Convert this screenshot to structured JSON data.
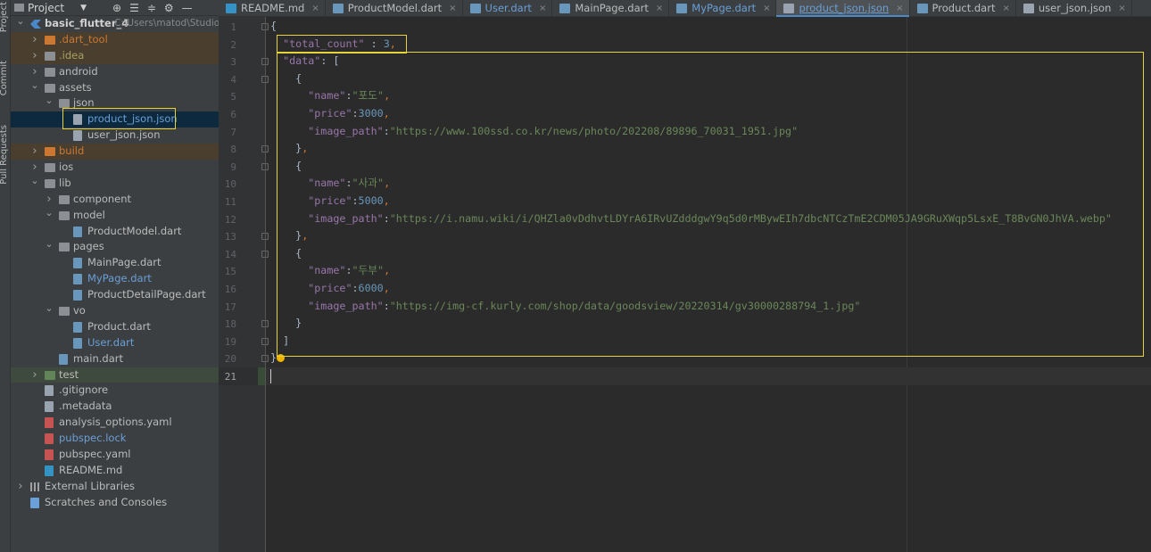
{
  "side_strip": {
    "labels": [
      "Project",
      "Commit",
      "Pull Requests"
    ]
  },
  "project_panel": {
    "title": "Project",
    "tree": [
      {
        "label": "basic_flutter_4",
        "suffix": "C:\\Users\\matod\\Studio",
        "depth": 0,
        "type": "root",
        "expanded": true
      },
      {
        "label": ".dart_tool",
        "depth": 1,
        "type": "folder-orange",
        "expanded": false,
        "style": "orange",
        "bg": "orange"
      },
      {
        "label": ".idea",
        "depth": 1,
        "type": "folder",
        "expanded": false,
        "style": "olive",
        "bg": "orange"
      },
      {
        "label": "android",
        "depth": 1,
        "type": "folder",
        "expanded": false
      },
      {
        "label": "assets",
        "depth": 1,
        "type": "folder",
        "expanded": true
      },
      {
        "label": "json",
        "depth": 2,
        "type": "folder",
        "expanded": true
      },
      {
        "label": "product_json.json",
        "depth": 3,
        "type": "json",
        "selected": true
      },
      {
        "label": "user_json.json",
        "depth": 3,
        "type": "json"
      },
      {
        "label": "build",
        "depth": 1,
        "type": "folder-orange",
        "expanded": false,
        "style": "orange",
        "bg": "orange"
      },
      {
        "label": "ios",
        "depth": 1,
        "type": "folder",
        "expanded": false
      },
      {
        "label": "lib",
        "depth": 1,
        "type": "folder",
        "expanded": true
      },
      {
        "label": "component",
        "depth": 2,
        "type": "folder",
        "expanded": false
      },
      {
        "label": "model",
        "depth": 2,
        "type": "folder",
        "expanded": true
      },
      {
        "label": "ProductModel.dart",
        "depth": 3,
        "type": "dart"
      },
      {
        "label": "pages",
        "depth": 2,
        "type": "folder",
        "expanded": true
      },
      {
        "label": "MainPage.dart",
        "depth": 3,
        "type": "dart"
      },
      {
        "label": "MyPage.dart",
        "depth": 3,
        "type": "dart",
        "style": "blue"
      },
      {
        "label": "ProductDetailPage.dart",
        "depth": 3,
        "type": "dart"
      },
      {
        "label": "vo",
        "depth": 2,
        "type": "folder",
        "expanded": true
      },
      {
        "label": "Product.dart",
        "depth": 3,
        "type": "dart"
      },
      {
        "label": "User.dart",
        "depth": 3,
        "type": "dart",
        "style": "blue"
      },
      {
        "label": "main.dart",
        "depth": 2,
        "type": "dart"
      },
      {
        "label": "test",
        "depth": 1,
        "type": "folder-test",
        "expanded": false,
        "bg": "green"
      },
      {
        "label": ".gitignore",
        "depth": 1,
        "type": "file"
      },
      {
        "label": ".metadata",
        "depth": 1,
        "type": "file"
      },
      {
        "label": "analysis_options.yaml",
        "depth": 1,
        "type": "file-red"
      },
      {
        "label": "pubspec.lock",
        "depth": 1,
        "type": "file-red",
        "style": "blue"
      },
      {
        "label": "pubspec.yaml",
        "depth": 1,
        "type": "file-red"
      },
      {
        "label": "README.md",
        "depth": 1,
        "type": "md"
      },
      {
        "label": "External Libraries",
        "depth": 0,
        "type": "libs",
        "expanded": false
      },
      {
        "label": "Scratches and Consoles",
        "depth": 0,
        "type": "scratch"
      }
    ]
  },
  "tabs": [
    {
      "label": "README.md",
      "icon": "md"
    },
    {
      "label": "ProductModel.dart",
      "icon": "dart"
    },
    {
      "label": "User.dart",
      "icon": "dart",
      "style": "blue"
    },
    {
      "label": "MainPage.dart",
      "icon": "dart"
    },
    {
      "label": "MyPage.dart",
      "icon": "dart",
      "style": "blue"
    },
    {
      "label": "product_json.json",
      "icon": "json",
      "active": true
    },
    {
      "label": "Product.dart",
      "icon": "dart"
    },
    {
      "label": "user_json.json",
      "icon": "json"
    }
  ],
  "editor": {
    "current_line": 21,
    "lines": [
      [
        [
          "{",
          "brk"
        ]
      ],
      [
        [
          "  ",
          ""
        ],
        [
          "\"total_count\"",
          "key"
        ],
        [
          " : ",
          ""
        ],
        [
          "3",
          "num"
        ],
        [
          ",",
          "pun"
        ]
      ],
      [
        [
          "  ",
          ""
        ],
        [
          "\"data\"",
          "key"
        ],
        [
          ": [",
          ""
        ]
      ],
      [
        [
          "    {",
          ""
        ]
      ],
      [
        [
          "      ",
          ""
        ],
        [
          "\"name\"",
          "key"
        ],
        [
          ":",
          ""
        ],
        [
          "\"포도\"",
          "str"
        ],
        [
          ",",
          "pun"
        ]
      ],
      [
        [
          "      ",
          ""
        ],
        [
          "\"price\"",
          "key"
        ],
        [
          ":",
          ""
        ],
        [
          "3000",
          "num"
        ],
        [
          ",",
          "pun"
        ]
      ],
      [
        [
          "      ",
          ""
        ],
        [
          "\"image_path\"",
          "key"
        ],
        [
          ":",
          ""
        ],
        [
          "\"https://www.100ssd.co.kr/news/photo/202208/89896_70031_1951.jpg\"",
          "str"
        ]
      ],
      [
        [
          "    }",
          ""
        ],
        [
          ",",
          "pun"
        ]
      ],
      [
        [
          "    {",
          ""
        ]
      ],
      [
        [
          "      ",
          ""
        ],
        [
          "\"name\"",
          "key"
        ],
        [
          ":",
          ""
        ],
        [
          "\"사과\"",
          "str"
        ],
        [
          ",",
          "pun"
        ]
      ],
      [
        [
          "      ",
          ""
        ],
        [
          "\"price\"",
          "key"
        ],
        [
          ":",
          ""
        ],
        [
          "5000",
          "num"
        ],
        [
          ",",
          "pun"
        ]
      ],
      [
        [
          "      ",
          ""
        ],
        [
          "\"image_path\"",
          "key"
        ],
        [
          ":",
          ""
        ],
        [
          "\"https://i.namu.wiki/i/QHZla0vDdhvtLDYrA6IRvUZdddgwY9q5d0rMBywEIh7dbcNTCzTmE2CDM05JA9GRuXWqp5LsxE_T8BvGN0JhVA.webp\"",
          "str"
        ]
      ],
      [
        [
          "    }",
          ""
        ],
        [
          ",",
          "pun"
        ]
      ],
      [
        [
          "    {",
          ""
        ]
      ],
      [
        [
          "      ",
          ""
        ],
        [
          "\"name\"",
          "key"
        ],
        [
          ":",
          ""
        ],
        [
          "\"두부\"",
          "str"
        ],
        [
          ",",
          "pun"
        ]
      ],
      [
        [
          "      ",
          ""
        ],
        [
          "\"price\"",
          "key"
        ],
        [
          ":",
          ""
        ],
        [
          "6000",
          "num"
        ],
        [
          ",",
          "pun"
        ]
      ],
      [
        [
          "      ",
          ""
        ],
        [
          "\"image_path\"",
          "key"
        ],
        [
          ":",
          ""
        ],
        [
          "\"https://img-cf.kurly.com/shop/data/goodsview/20220314/gv30000288794_1.jpg\"",
          "str"
        ]
      ],
      [
        [
          "    }",
          ""
        ]
      ],
      [
        [
          "  ]",
          ""
        ]
      ],
      [
        [
          "}",
          ""
        ]
      ],
      [
        [
          "",
          ""
        ]
      ]
    ]
  }
}
